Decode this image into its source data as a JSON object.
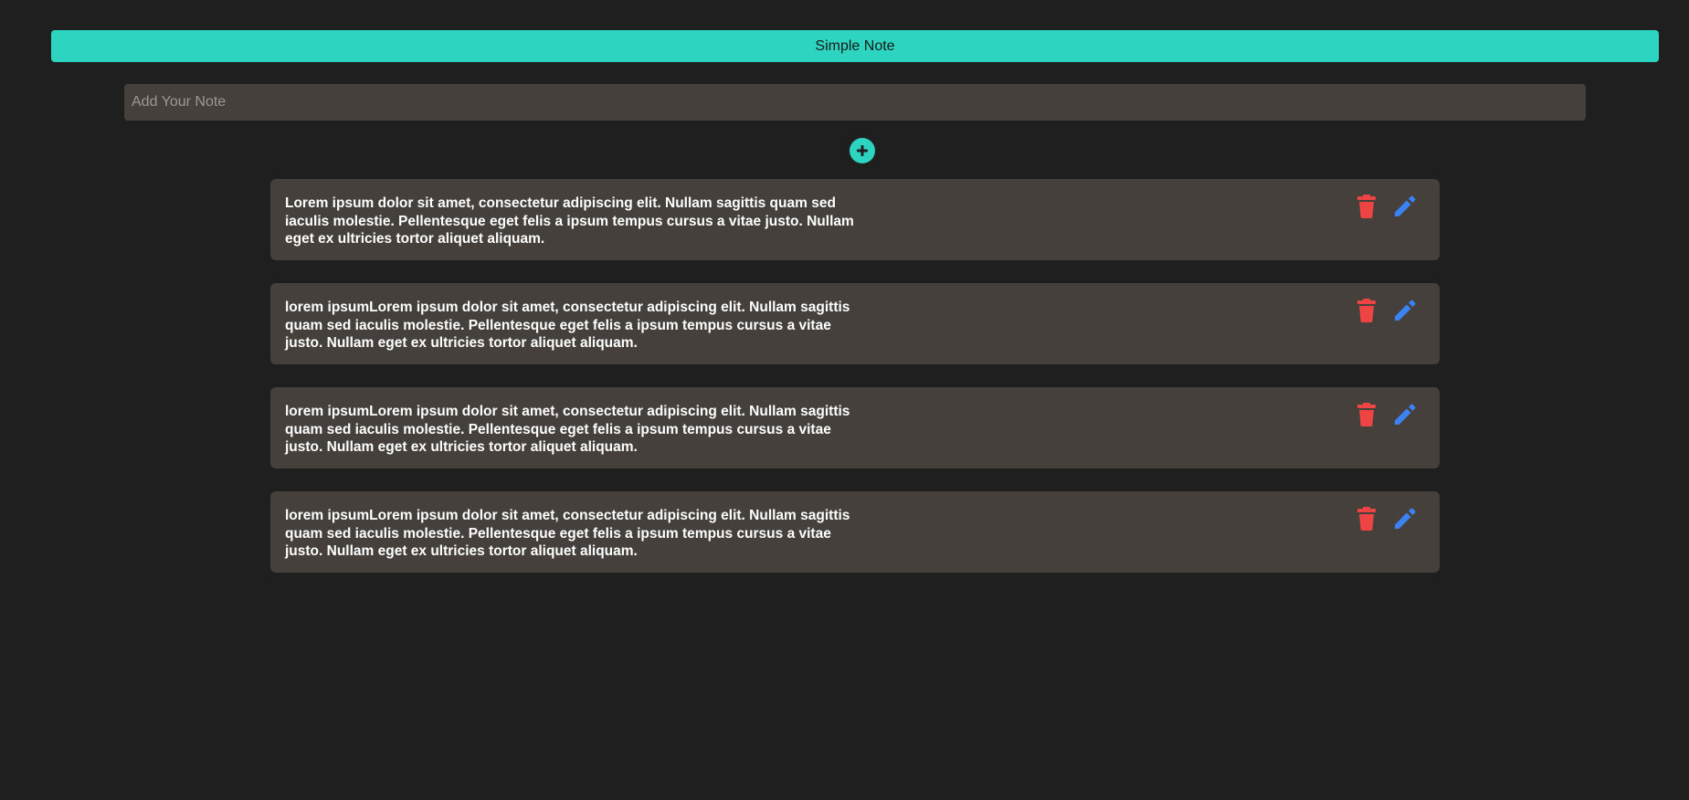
{
  "header": {
    "title": "Simple Note",
    "color": "#2dd4bf"
  },
  "input": {
    "placeholder": "Add Your Note",
    "value": ""
  },
  "add_button": {
    "icon": "plus-circle-icon"
  },
  "notes": [
    {
      "text": "Lorem ipsum dolor sit amet, consectetur adipiscing elit. Nullam sagittis quam sed iaculis molestie. Pellentesque eget felis a ipsum tempus cursus a vitae justo. Nullam eget ex ultricies tortor aliquet aliquam."
    },
    {
      "text": "lorem ipsumLorem ipsum dolor sit amet, consectetur adipiscing elit. Nullam sagittis quam sed iaculis molestie. Pellentesque eget felis a ipsum tempus cursus a vitae justo. Nullam eget ex ultricies tortor aliquet aliquam."
    },
    {
      "text": "lorem ipsumLorem ipsum dolor sit amet, consectetur adipiscing elit. Nullam sagittis quam sed iaculis molestie. Pellentesque eget felis a ipsum tempus cursus a vitae justo. Nullam eget ex ultricies tortor aliquet aliquam."
    },
    {
      "text": "lorem ipsumLorem ipsum dolor sit amet, consectetur adipiscing elit. Nullam sagittis quam sed iaculis molestie. Pellentesque eget felis a ipsum tempus cursus a vitae justo. Nullam eget ex ultricies tortor aliquet aliquam."
    }
  ],
  "icons": {
    "delete": "trash-icon",
    "edit": "pencil-icon",
    "delete_color": "#ef4444",
    "edit_color": "#3b82f6"
  }
}
